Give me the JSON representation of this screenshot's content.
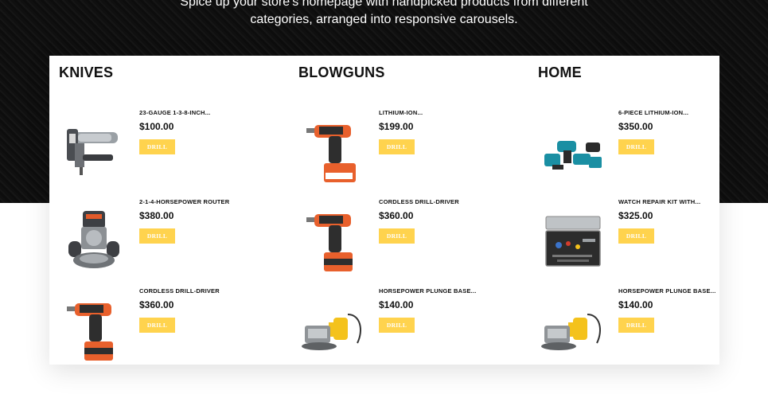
{
  "hero": {
    "line1": "Spice up your store's homepage with handpicked products from different",
    "line2": "categories, arranged into responsive carousels."
  },
  "colors": {
    "accent": "#ffd34e",
    "hero_bg": "#121212",
    "panel_bg": "#ffffff"
  },
  "columns": [
    {
      "title": "KNIVES",
      "items": [
        {
          "name": "23-GAUGE 1-3-8-INCH...",
          "price": "$100.00",
          "tag": "DRILL",
          "icon": "nailer-image"
        },
        {
          "name": "2-1-4-HORSEPOWER ROUTER",
          "price": "$380.00",
          "tag": "DRILL",
          "icon": "router-image"
        },
        {
          "name": "CORDLESS DRILL-DRIVER",
          "price": "$360.00",
          "tag": "DRILL",
          "icon": "drill-image"
        }
      ]
    },
    {
      "title": "BLOWGUNS",
      "items": [
        {
          "name": "LITHIUM-ION...",
          "price": "$199.00",
          "tag": "DRILL",
          "icon": "drill-image"
        },
        {
          "name": "CORDLESS DRILL-DRIVER",
          "price": "$360.00",
          "tag": "DRILL",
          "icon": "drill-image"
        },
        {
          "name": "HORSEPOWER PLUNGE BASE...",
          "price": "$140.00",
          "tag": "DRILL",
          "icon": "plunge-base-image"
        }
      ]
    },
    {
      "title": "HOME",
      "items": [
        {
          "name": "6-PIECE LITHIUM-ION...",
          "price": "$350.00",
          "tag": "DRILL",
          "icon": "tool-kit-image"
        },
        {
          "name": "WATCH REPAIR KIT WITH...",
          "price": "$325.00",
          "tag": "DRILL",
          "icon": "repair-case-image"
        },
        {
          "name": "HORSEPOWER PLUNGE BASE...",
          "price": "$140.00",
          "tag": "DRILL",
          "icon": "plunge-base-image"
        }
      ]
    }
  ]
}
